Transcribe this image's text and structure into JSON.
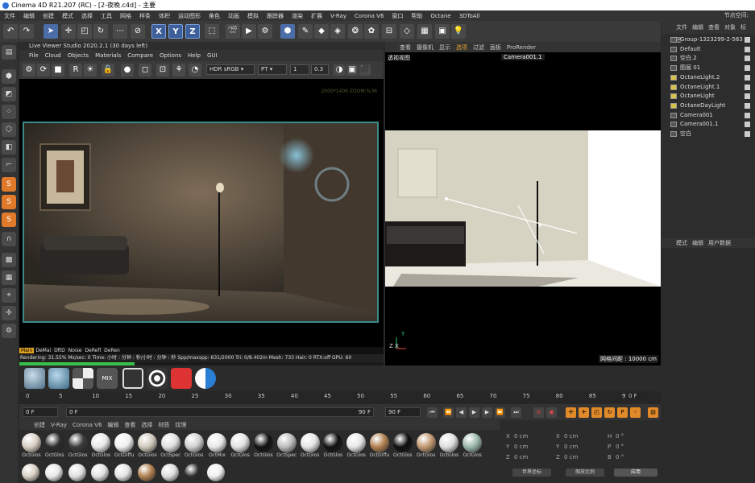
{
  "window": {
    "title": "Cinema 4D R21.207 (RC) - [2-夜晚.c4d] - 主要"
  },
  "menubar": {
    "items": [
      "文件",
      "编辑",
      "创建",
      "模式",
      "选择",
      "工具",
      "网格",
      "样条",
      "体积",
      "运动图形",
      "角色",
      "动画",
      "模拟",
      "跟踪器",
      "渲染",
      "扩展",
      "V-Ray",
      "Corona V6",
      "窗口",
      "帮助",
      "Octane",
      "3DToAll"
    ],
    "node_space": "节点空间:"
  },
  "toolbar": {
    "axis": [
      "X",
      "Y",
      "Z"
    ]
  },
  "liveviewer": {
    "title": "Live Viewer Studio 2020.2.1 (30 days left)",
    "menu": [
      "File",
      "Cloud",
      "Objects",
      "Materials",
      "Compare",
      "Options",
      "Help",
      "GUI"
    ],
    "tonemap": "HDR sRGB",
    "kernel": "PT",
    "layer": "1",
    "exposure": "0.3",
    "resolution": "2500*1406 ZOOM:%36",
    "tabs": [
      "Main",
      "DeMai",
      "DftD",
      "Noise",
      "DeRefl",
      "DeRen"
    ],
    "status": "Rendering: 31.55%  Ms/sec: 0   Time: 小时 : 分钟 : 秒/小时 : 分钟 : 秒   Spp/maxspp: 631/2000   Tri: 0/8.402m  Mesh: 733  Hair: 0   RTX:off        GPU:   60",
    "progress": 0.3155
  },
  "viewport": {
    "menu": [
      "查看",
      "摄像机",
      "显示",
      "选项",
      "过滤",
      "面板",
      "ProRender"
    ],
    "label": "透视视图",
    "camera": "Camera001.1",
    "grid": "网格间距 : 10000 cm",
    "axis_y": "Y",
    "axis_zx": "Z X"
  },
  "object_manager": {
    "tabs": [
      "文件",
      "编辑",
      "查看",
      "对象",
      "标签"
    ],
    "objects": [
      {
        "name": "Group-1323299-2-563"
      },
      {
        "name": "Default"
      },
      {
        "name": "空白.2"
      },
      {
        "name": "图层 01"
      },
      {
        "name": "OctaneLight.2"
      },
      {
        "name": "OctaneLight.1"
      },
      {
        "name": "OctaneLight"
      },
      {
        "name": "OctaneDayLight"
      },
      {
        "name": "Camera001"
      },
      {
        "name": "Camera001.1"
      },
      {
        "name": "空白"
      }
    ]
  },
  "attributes": {
    "tabs": [
      "模式",
      "编辑",
      "用户数据"
    ]
  },
  "timeline": {
    "ticks": [
      "0",
      "5",
      "10",
      "15",
      "20",
      "25",
      "30",
      "35",
      "40",
      "45",
      "50",
      "55",
      "60",
      "65",
      "70",
      "75",
      "80",
      "85",
      "90"
    ],
    "current_frame_right": "0 F",
    "start": "0 F",
    "min": "0 F",
    "max": "90 F",
    "end": "90 F"
  },
  "material_manager": {
    "tabs": [
      "创建",
      "V-Ray",
      "Corona V6",
      "编辑",
      "查看",
      "选择",
      "材质",
      "纹理"
    ],
    "materials": [
      "OctGlos",
      "OctGlos",
      "OctGlos",
      "OctGlos",
      "OctDiffu",
      "OctGlos",
      "OctSpec",
      "OctGlos",
      "OctMix",
      "OctGlos",
      "OctGlos",
      "OctSpec",
      "OctGlos",
      "OctGlos",
      "OctGlos",
      "OctDiffu",
      "OctGlos",
      "OctGlos",
      "OctGlos",
      "OctGlos"
    ]
  },
  "coordinates": {
    "rows": [
      {
        "a": "X",
        "av": "0 cm",
        "b": "X",
        "bv": "0 cm",
        "c": "H",
        "cv": "0 °"
      },
      {
        "a": "Y",
        "av": "0 cm",
        "b": "Y",
        "bv": "0 cm",
        "c": "P",
        "cv": "0 °"
      },
      {
        "a": "Z",
        "av": "0 cm",
        "b": "Z",
        "bv": "0 cm",
        "c": "B",
        "cv": "0 °"
      }
    ],
    "mode": "世界坐标",
    "scale": "缩放比例",
    "apply": "应用"
  }
}
